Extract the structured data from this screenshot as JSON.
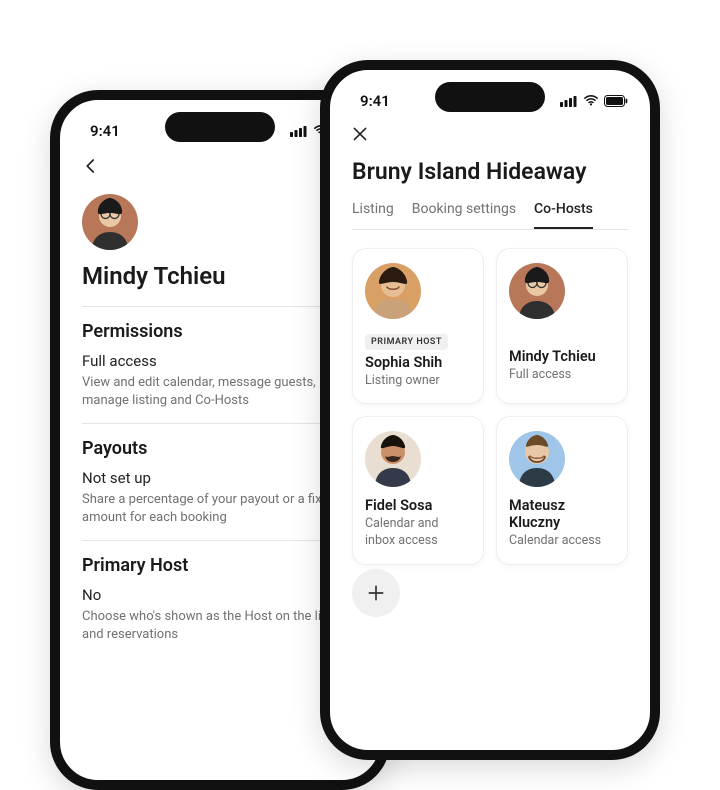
{
  "statusbar": {
    "time": "9:41"
  },
  "left": {
    "profile_name": "Mindy Tchieu",
    "sections": {
      "permissions": {
        "title": "Permissions",
        "value": "Full access",
        "desc": "View and edit calendar, message guests, manage listing and Co-Hosts"
      },
      "payouts": {
        "title": "Payouts",
        "value": "Not set up",
        "desc": "Share a percentage of your payout or a fixed amount for each booking"
      },
      "primary_host": {
        "title": "Primary Host",
        "value": "No",
        "desc": "Choose who's shown as the Host on the listing and reservations"
      }
    }
  },
  "right": {
    "title": "Bruny Island Hideaway",
    "tabs": {
      "listing": "Listing",
      "booking": "Booking settings",
      "cohosts": "Co-Hosts"
    },
    "hosts": {
      "sophia": {
        "badge": "PRIMARY HOST",
        "name": "Sophia Shih",
        "sub": "Listing owner"
      },
      "mindy": {
        "name": "Mindy Tchieu",
        "sub": "Full access"
      },
      "fidel": {
        "name": "Fidel Sosa",
        "sub": "Calendar and inbox access"
      },
      "mateusz": {
        "name": "Mateusz Kluczny",
        "sub": "Calendar access"
      }
    }
  }
}
